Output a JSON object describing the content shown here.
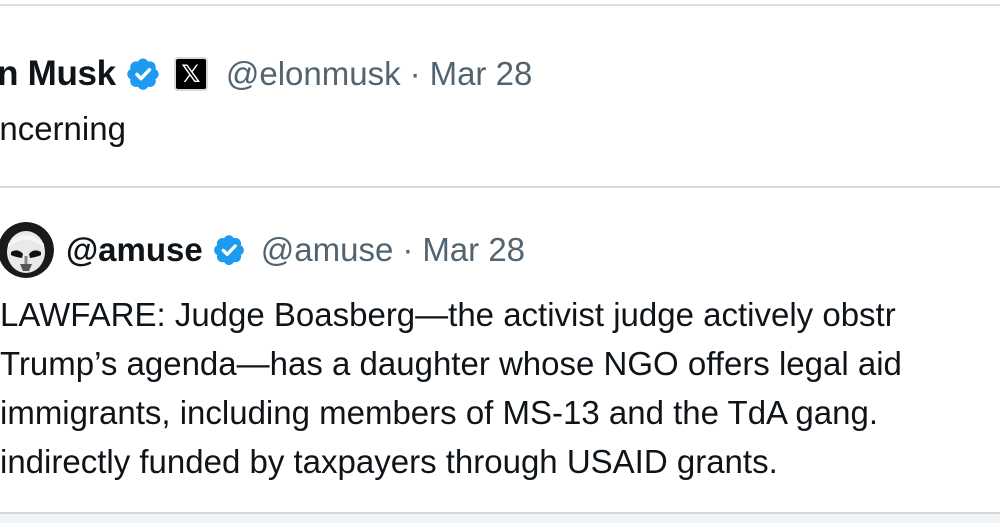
{
  "main_post": {
    "display_name": "on Musk",
    "x_badge": "𝕏",
    "handle": "@elonmusk",
    "separator": "·",
    "date": "Mar 28",
    "text": "oncerning",
    "verified_icon": "verified-badge-icon",
    "badge_icon": "x-logo-icon"
  },
  "quoted_post": {
    "display_name": "@amuse",
    "handle": "@amuse",
    "separator": "·",
    "date": "Mar 28",
    "avatar_icon": "stormtrooper-avatar-icon",
    "verified_icon": "verified-badge-icon",
    "lines": [
      "LAWFARE: Judge Boasberg—the activist judge actively obstr",
      "Trump’s agenda—has a daughter whose NGO offers legal aid",
      "immigrants, including members of MS-13 and the TdA gang.",
      "indirectly funded by taxpayers through USAID grants."
    ]
  },
  "colors": {
    "text": "#0f1419",
    "secondary": "#536471",
    "verified": "#1d9bf0",
    "border": "#cfd9de"
  }
}
